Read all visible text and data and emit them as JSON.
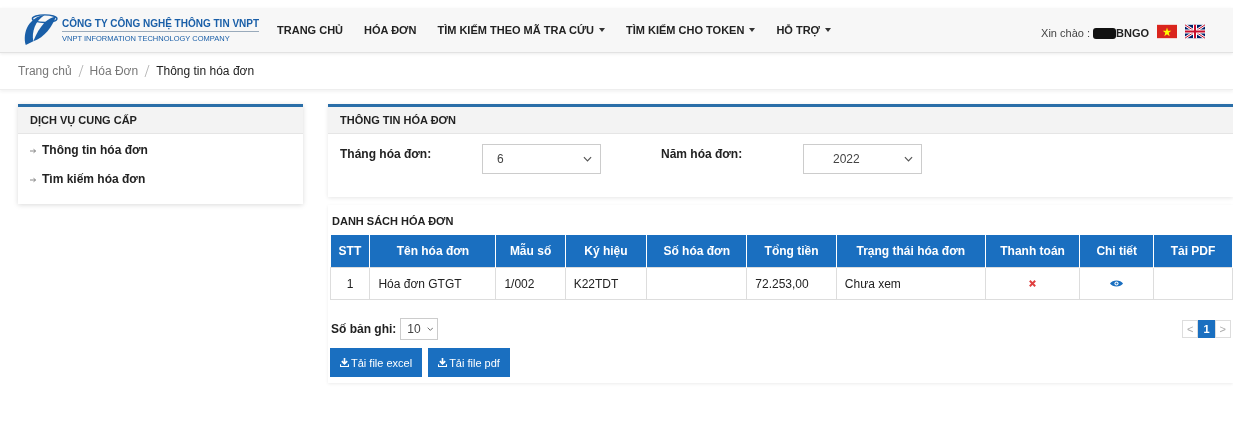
{
  "brand": {
    "name": "CÔNG TY CÔNG NGHỆ THÔNG TIN VNPT",
    "subtitle": "VNPT INFORMATION TECHNOLOGY COMPANY"
  },
  "nav": [
    {
      "label": "TRANG CHỦ",
      "dropdown": false
    },
    {
      "label": "HÓA ĐƠN",
      "dropdown": false
    },
    {
      "label": "TÌM KIẾM THEO MÃ TRA CỨU",
      "dropdown": true
    },
    {
      "label": "TÌM KIẾM CHO TOKEN",
      "dropdown": true
    },
    {
      "label": "HỖ TRỢ",
      "dropdown": true
    }
  ],
  "greeting": {
    "label": "Xin chào :",
    "user": "BNGO"
  },
  "breadcrumb": [
    {
      "label": "Trang chủ",
      "current": false
    },
    {
      "label": "Hóa Đơn",
      "current": false
    },
    {
      "label": "Thông tin hóa đơn",
      "current": true
    }
  ],
  "sidebar": {
    "title": "DỊCH VỤ CUNG CẤP",
    "items": [
      "Thông tin hóa đơn",
      "Tìm kiếm hóa đơn"
    ]
  },
  "invoice_info": {
    "title": "THÔNG TIN HÓA ĐƠN",
    "month_label": "Tháng hóa đơn:",
    "month": "6",
    "year_label": "Năm hóa đơn:",
    "year": "2022"
  },
  "list": {
    "title": "DANH SÁCH HÓA ĐƠN",
    "columns": [
      "STT",
      "Tên hóa đơn",
      "Mẫu số",
      "Ký hiệu",
      "Số hóa đơn",
      "Tổng tiền",
      "Trạng thái hóa đơn",
      "Thanh toán",
      "Chi tiết",
      "Tải PDF"
    ],
    "rows": [
      {
        "cells": [
          "1",
          "Hóa đơn GTGT",
          "1/002",
          "K22TDT",
          "",
          "72.253,00",
          "Chưa xem"
        ],
        "paid": false
      }
    ],
    "page_size_label": "Số bản ghi:",
    "page_size": "10",
    "pages": [
      {
        "label": "<",
        "selected": false
      },
      {
        "label": "1",
        "selected": true
      },
      {
        "label": ">",
        "selected": false
      }
    ],
    "buttons": [
      "Tải file excel",
      "Tải file pdf"
    ]
  }
}
